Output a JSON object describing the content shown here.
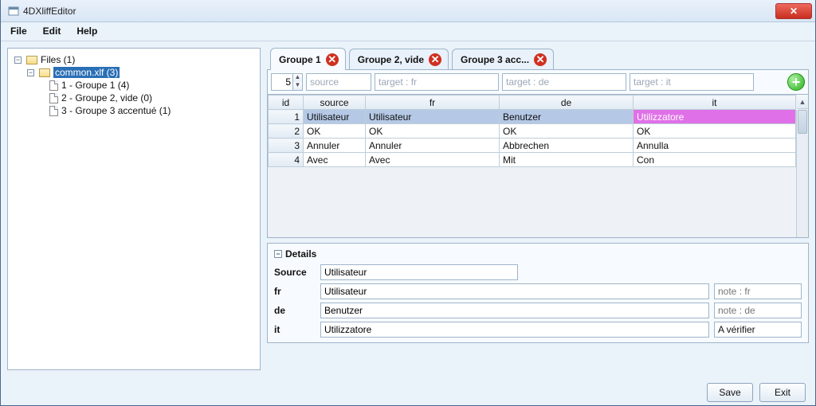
{
  "window": {
    "title": "4DXliffEditor"
  },
  "menu": {
    "file": "File",
    "edit": "Edit",
    "help": "Help"
  },
  "tree": {
    "root": "Files (1)",
    "file": "common.xlf (3)",
    "g1": "1 - Groupe 1 (4)",
    "g2": "2 - Groupe 2, vide (0)",
    "g3": "3 - Groupe 3 accentué (1)"
  },
  "tabs": {
    "t1": "Groupe 1",
    "t2": "Groupe 2, vide",
    "t3": "Groupe 3 acc..."
  },
  "filter": {
    "count": "5",
    "ph_source": "source",
    "ph_fr": "target : fr",
    "ph_de": "target : de",
    "ph_it": "target : it"
  },
  "cols": {
    "id": "id",
    "source": "source",
    "fr": "fr",
    "de": "de",
    "it": "it"
  },
  "rows": [
    {
      "id": "1",
      "source": "Utilisateur",
      "fr": "Utilisateur",
      "de": "Benutzer",
      "it": "Utilizzatore"
    },
    {
      "id": "2",
      "source": "OK",
      "fr": "OK",
      "de": "OK",
      "it": "OK"
    },
    {
      "id": "3",
      "source": "Annuler",
      "fr": "Annuler",
      "de": "Abbrechen",
      "it": "Annulla"
    },
    {
      "id": "4",
      "source": "Avec",
      "fr": "Avec",
      "de": "Mit",
      "it": "Con"
    }
  ],
  "details": {
    "title": "Details",
    "labels": {
      "source": "Source",
      "fr": "fr",
      "de": "de",
      "it": "it"
    },
    "values": {
      "source": "Utilisateur",
      "fr": "Utilisateur",
      "de": "Benutzer",
      "it": "Utilizzatore"
    },
    "notes": {
      "fr_ph": "note : fr",
      "de_ph": "note : de",
      "it": "A vérifier"
    }
  },
  "buttons": {
    "save": "Save",
    "exit": "Exit"
  }
}
